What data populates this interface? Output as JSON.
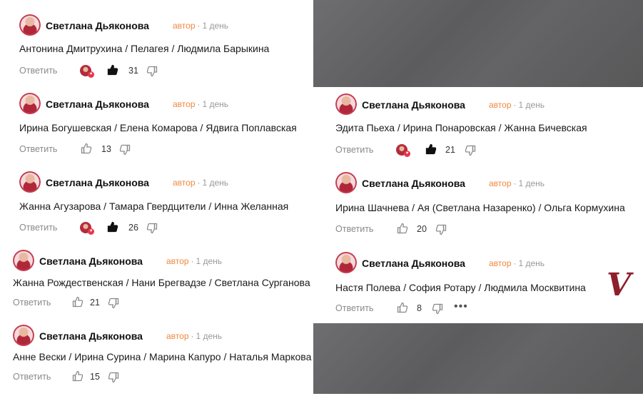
{
  "author_label": "автор",
  "time_label": "1 день",
  "reply_label": "Ответить",
  "more_label": "•••",
  "signature": "V",
  "colors": {
    "author": "#f0883c",
    "background_panel": "#626264",
    "text": "#1a1a1a"
  },
  "comments": [
    {
      "name": "Светлана Дьяконова",
      "text": "Антонина Дмитрухина / Пелагея / Людмила Барыкина",
      "likes": "31",
      "liked": true
    },
    {
      "name": "Светлана Дьяконова",
      "text": "Ирина Богушевская / Елена Комарова / Ядвига Поплавская",
      "likes": "13",
      "liked": false
    },
    {
      "name": "Светлана Дьяконова",
      "text": "Жанна Агузарова / Тамара Гвердцители / Инна Желанная",
      "likes": "26",
      "liked": true
    },
    {
      "name": "Светлана Дьяконова",
      "text": "Жанна Рождественская / Нани Брегвадзе / Светлана Сурганова",
      "likes": "21",
      "liked": false
    },
    {
      "name": "Светлана Дьяконова",
      "text": "Анне Вески / Ирина Сурина / Марина Капуро / Наталья Маркова",
      "likes": "15",
      "liked": false
    },
    {
      "name": "Светлана Дьяконова",
      "text": "Эдита Пьеха / Ирина Понаровская / Жанна Бичевская",
      "likes": "21",
      "liked": true
    },
    {
      "name": "Светлана Дьяконова",
      "text": "Ирина Шачнева / Ая (Светлана Назаренко) / Ольга Кормухина",
      "likes": "20",
      "liked": false
    },
    {
      "name": "Светлана Дьяконова",
      "text": "Настя Полева / София Ротару / Людмила Москвитина",
      "likes": "8",
      "liked": false
    }
  ]
}
